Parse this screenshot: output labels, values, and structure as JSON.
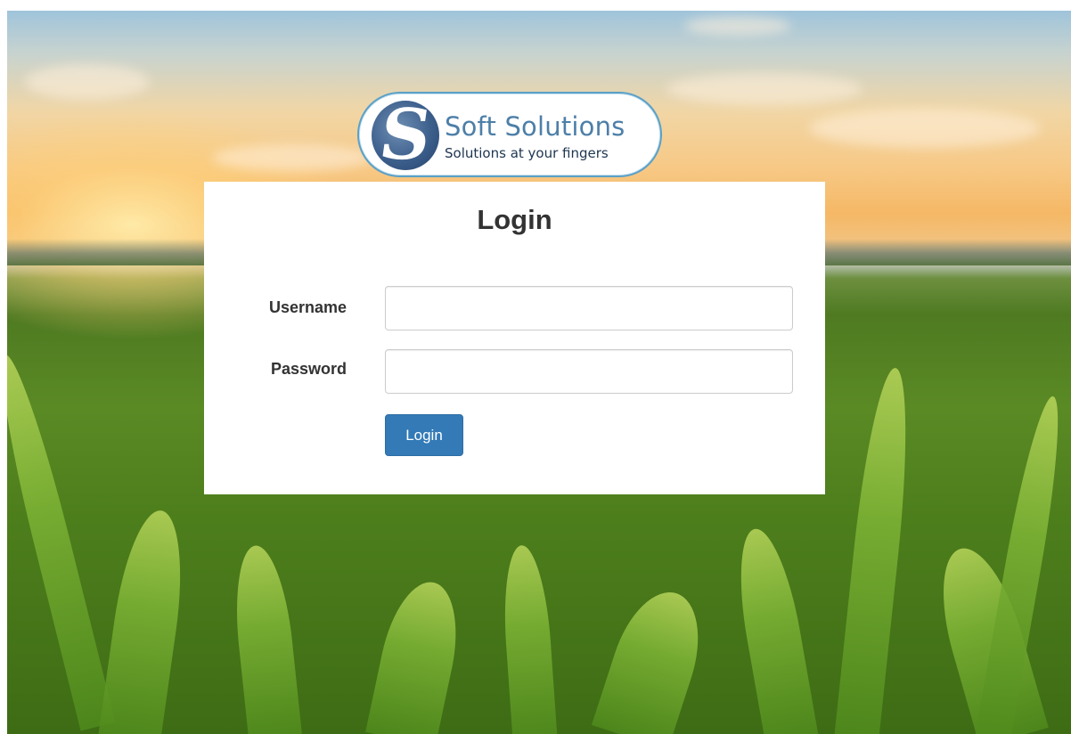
{
  "logo": {
    "mark_letter": "S",
    "title": "Soft Solutions",
    "subtitle": "Solutions at your fingers"
  },
  "login_form": {
    "title": "Login",
    "username_label": "Username",
    "username_value": "",
    "password_label": "Password",
    "password_value": "",
    "submit_label": "Login"
  },
  "colors": {
    "button_primary": "#337ab7",
    "logo_text": "#4d7fa8",
    "logo_border": "#5aa0c8"
  },
  "icons": {
    "logo_mark": "soft-solutions-s-logo-icon"
  }
}
